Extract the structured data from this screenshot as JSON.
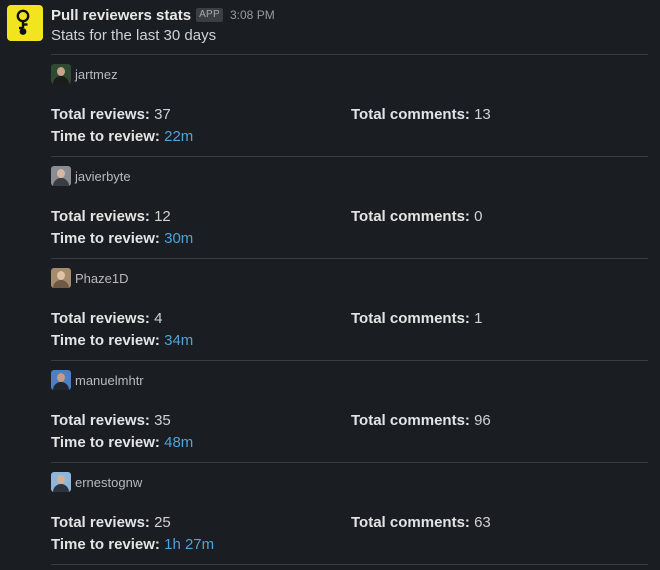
{
  "message": {
    "sender": "Pull reviewers stats",
    "badge": "APP",
    "time": "3:08 PM",
    "subtitle": "Stats for the last 30 days"
  },
  "labels": {
    "total_reviews": "Total reviews:",
    "total_comments": "Total comments:",
    "time_to_review": "Time to review:"
  },
  "reviewers": [
    {
      "username": "jartmez",
      "total_reviews": "37",
      "total_comments": "13",
      "time_to_review": "22m",
      "avatar_bg": "#2f4a32",
      "avatar_fg": "#1c1c1c",
      "avatar_face": "#c9a48a"
    },
    {
      "username": "javierbyte",
      "total_reviews": "12",
      "total_comments": "0",
      "time_to_review": "30m",
      "avatar_bg": "#8a8d92",
      "avatar_fg": "#3a3d44",
      "avatar_face": "#d6b8a4"
    },
    {
      "username": "Phaze1D",
      "total_reviews": "4",
      "total_comments": "1",
      "time_to_review": "34m",
      "avatar_bg": "#a68c6e",
      "avatar_fg": "#6e5a44",
      "avatar_face": "#e0c2a5"
    },
    {
      "username": "manuelmhtr",
      "total_reviews": "35",
      "total_comments": "96",
      "time_to_review": "48m",
      "avatar_bg": "#4d7fc4",
      "avatar_fg": "#20252e",
      "avatar_face": "#c59c84"
    },
    {
      "username": "ernestognw",
      "total_reviews": "25",
      "total_comments": "63",
      "time_to_review": "1h 27m",
      "avatar_bg": "#8fb6d8",
      "avatar_fg": "#2d3440",
      "avatar_face": "#d3b199"
    }
  ],
  "colors": {
    "background": "#1a1d21",
    "link": "#4ea3d9",
    "app_icon_bg": "#f2e41f"
  },
  "icons": {
    "app_avatar": "git-branch-icon"
  }
}
